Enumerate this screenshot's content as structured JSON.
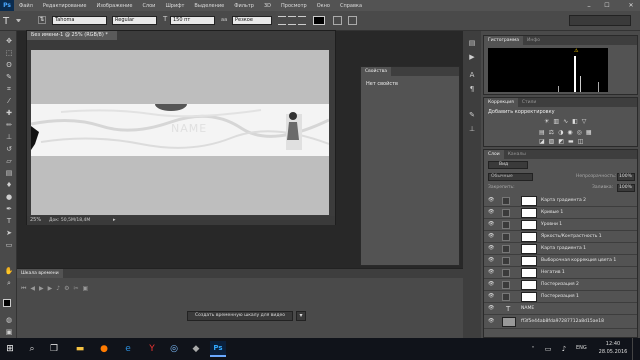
{
  "app": {
    "logo": "Ps"
  },
  "menu": [
    "Файл",
    "Редактирование",
    "Изображение",
    "Слои",
    "Шрифт",
    "Выделение",
    "Фильтр",
    "3D",
    "Просмотр",
    "Окно",
    "Справка"
  ],
  "window_controls": {
    "minimize": "–",
    "maximize": "☐",
    "close": "✕"
  },
  "options": {
    "tool_glyph": "T",
    "font_family": "Tahoma",
    "font_style": "Regular",
    "font_size": "150 пт",
    "aa_label": "aa",
    "antialias": "Резкое",
    "text_color": "#000000"
  },
  "document": {
    "tab_title": "Без имени-1 @ 25% (RGB/8) *",
    "zoom": "25%",
    "doc_info": "Док: 50,5M/18,4M",
    "banner_text": "NAME",
    "arrow": "▸"
  },
  "properties": {
    "tab": "Свойства",
    "body": "Нет свойств"
  },
  "timeline": {
    "tab": "Шкала времени",
    "create_button": "Создать временную шкалу для видео",
    "dropdown_arrow": "▾"
  },
  "histogram": {
    "tabs": [
      "Гистограмма",
      "Инфо"
    ],
    "warn": "⚠"
  },
  "adjustments": {
    "tabs": [
      "Коррекция",
      "Стили"
    ],
    "title": "Добавить корректировку"
  },
  "layers": {
    "tabs": [
      "Слои",
      "Каналы"
    ],
    "filter_label": "Вид",
    "blend_mode": "Обычные",
    "opacity_label": "Непрозрачность:",
    "opacity_value": "100%",
    "lock_label": "Закрепить:",
    "fill_label": "Заливка:",
    "fill_value": "100%",
    "items": [
      "Карта градиента 2",
      "Кривые 1",
      "Уровни 1",
      "Яркость/Контрастность 1",
      "Карта градиента 1",
      "Выборочная коррекция цвета 1",
      "Негатив 1",
      "Постеризация 2",
      "Постеризация 1",
      "NAME",
      "ff3f5e44ab8fda97287712a8d15ae18"
    ]
  },
  "taskbar": {
    "start": "⊞",
    "search": "⌕",
    "task_view": "❐",
    "lang": "ENG",
    "time": "12:40",
    "date": "28.05.2016"
  },
  "colors": {
    "accent": "#31a8ff",
    "panel": "#535353",
    "dark": "#282828",
    "menu": "#535353"
  }
}
